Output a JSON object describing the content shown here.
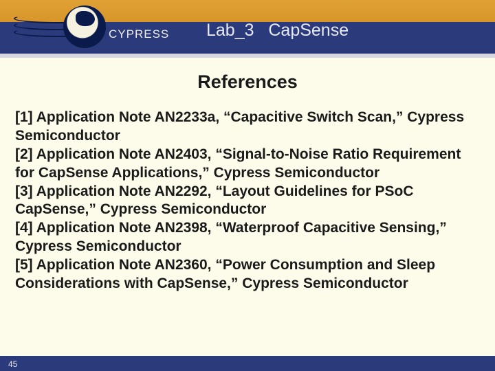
{
  "header": {
    "logo_text": "CYPRESS",
    "title": "Lab_3   CapSense"
  },
  "heading": "References",
  "references": [
    "[1] Application Note AN2233a, “Capacitive Switch Scan,” Cypress Semiconductor",
    "[2] Application Note AN2403, “Signal-to-Noise Ratio Requirement for CapSense Applications,” Cypress Semiconductor",
    "[3] Application Note AN2292, “Layout Guidelines for PSoC CapSense,” Cypress Semiconductor",
    "[4] Application Note AN2398, “Waterproof Capacitive Sensing,” Cypress Semiconductor",
    "[5] Application Note AN2360, “Power Consumption and Sleep Considerations with CapSense,” Cypress Semiconductor"
  ],
  "footer": {
    "page_number": "45"
  }
}
